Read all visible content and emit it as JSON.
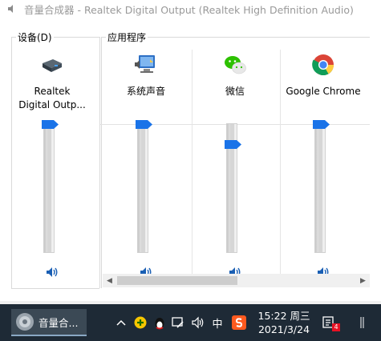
{
  "window": {
    "title": "音量合成器 - Realtek Digital Output (Realtek High Definition Audio)"
  },
  "groups": {
    "device_label": "设备(D)",
    "apps_label": "应用程序"
  },
  "channels": [
    {
      "name_line1": "Realtek",
      "name_line2": "Digital Outp...",
      "icon": "audio-device-icon",
      "volume": 1.0
    },
    {
      "name_line1": "系统声音",
      "name_line2": "",
      "icon": "system-sounds-icon",
      "volume": 1.0
    },
    {
      "name_line1": "微信",
      "name_line2": "",
      "icon": "wechat-icon",
      "volume": 0.84
    },
    {
      "name_line1": "Google Chrome",
      "name_line2": "",
      "icon": "chrome-icon",
      "volume": 1.0
    }
  ],
  "hscroll": {
    "position": 0.0
  },
  "taskbar": {
    "app_label": "音量合...",
    "ime_label": "中",
    "time": "15:22 周三",
    "date": "2021/3/24",
    "notification_count": "4"
  },
  "colors": {
    "thumb": "#1a73e8",
    "taskbar": "#1e2a36",
    "speaker": "#1a5fb4"
  }
}
